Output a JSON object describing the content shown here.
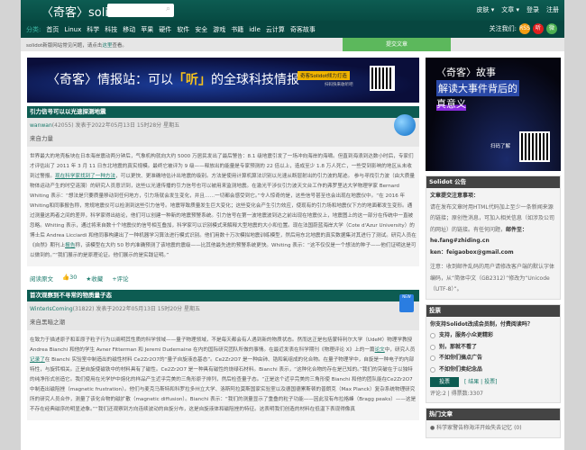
{
  "header": {
    "logo": "〈奇客〉solidot",
    "search_icon": "⌕",
    "skin": "皮肤 ▾",
    "article": "文章 ▾",
    "login": "登录",
    "register": "注册"
  },
  "nav": {
    "label": "分类:",
    "items": [
      "首页",
      "Linux",
      "科学",
      "科技",
      "移动",
      "苹果",
      "硬件",
      "软件",
      "安全",
      "游戏",
      "书籍",
      "idle",
      "云计算",
      "奇客故事"
    ],
    "follow": "关注我们:",
    "rss": "RSS",
    "listen": "听",
    "wechat": "微"
  },
  "notice": {
    "pre": "solidot新版网站常见问题，请点击",
    "link": "这里",
    "post": "查看。",
    "submit": "提交文章"
  },
  "banner": {
    "title_a": "〈奇客〉情报站：可以",
    "title_b": "「听」",
    "title_c": "的全球科技情报",
    "tag": "奇客Solidot倾力打造",
    "sub": "扫码快来收听吧"
  },
  "articles": [
    {
      "title": "引力信号可以以光速探测地震",
      "author": "wanwan",
      "meta": "(42055) 发表于2022年05月13日 15时28分 星期五",
      "from": "来自力量",
      "p1": "世界最大的地壳板块在日本海岸震动两分钟后，气象机构就向大约 5000 万居民发出了最后警告：8.1 级地震引发了一场冲向海岸的海啸。但直到海浪到达数小时后，专家们才评估出了 2011 年 3 月 11 日东北地震的真实规模。最终它被评为 9 级——释放出的能量是专家预测的 22 倍以上，造成至少 1.8 万人死亡，一些受到影响的地区从未收到过警报。",
      "link1": "现在科学家找到了一种方法",
      "p2": "，可以更快、更准确地估计出地震的级别。方法是使用计算机算法识别以光速从断层射出的引力波的尾迹。 参与寻找引力波（由大质量物体运动产生的时空涟漪）的研究人员意识到，这些以光速传播的引力信号也可以被用来监测地震。在激光干涉仪引力波天文台工作的弗罗里达大学物理学家 Bernard Whiting 表示：“想法是只要质量移动到任何地方，引力场就会发生变化，并且……一切都会感受到它。”令人惊奇的是，这些信号甚至也会出现在地震仪中。“在 2016 年 Whiting和同事报告称，常规地震仪可以检测到这些引力信号。地震导致质量发生巨大变化；这些变化会产生引力效应，使现有的引力场和地震仪下方的地面都发生变形。通过测量这两者之间的差异，科学家得出结论，他们可以创建一种新的地震预警系统。引力信号在第一波地震波到达之前出现在地震仪上，地震图上的这一部分在传统中一直被忽略。Whiting 表示，通过将来自数十个地震仪的信号相互叠加，科学家可以识别模式来解释大型地震的大小和位置。现在法国蔚蓝海岸大学（Cote d'Azur University）的博士后 Andrea Licciardi 和他同事构建出了一种机器学习算法进行模式识别。他们用数十万次模拟地震训练模型，然后用东北地震的真实数据集对其进行了测试。研究人员在《自然》期刊上",
      "link2": "报告",
      "p3": "称，该模型在大约 50 秒内准确预测了该地震的震级——比其他最先进的预警系统更快。Whiting 表示：“这不仅仅是一个想法的种子——他们证明这是可以做到的。”“我们展示的是原理论证。他们展示的是实践证明。”",
      "read": "阅读原文",
      "likes": "30",
      "fav": "收藏",
      "comment": "评论"
    },
    {
      "title": "首次观察到不寻常的物质量子态",
      "author": "WinterIsComing",
      "meta": "(31822) 发表于2022年05月13日 15时20分 星期五",
      "from": "来自黑暗之潮",
      "badge": "NEW",
      "p1": "在致力于描述原子和亚原子粒子行为以阐明其性质的科学领域——量子物理领域，不是每天都会有人遇到新的物质状态。然而这正是包括蒙特利尔大学（UdeM）物理学教授 Andrea Bianchi 和他的学生 Avner Fitterman 和 Jeremi Dudemaine 在内的国际研究团队所做的事情。在最近发表在科学期刊《物理评论 X》上的一篇",
      "link1": "论文",
      "mid": "中，研究人员",
      "link2": "记录了",
      "p2": "在 Bianchi 实验室中制造出的磁性材料 Ce2Zr2O7的“量子自旋液态基态”。Ce2Zr2O7 是一种由铈、锆和氧组成的化合物。在量子物理学中，自旋是一种电子的内部特性，与旋转相关。正是自旋使磁铁中的材料具有了磁性。Ce2Zr2O7 是一种具有磁性的烧绿石材料。Bianchi 表示，“这种化合物的存在是已知的。”我们的突破在于以独特的纯净形式创造它。我们使用在光学炉中熔化的样品产生近乎完美的三角形原子排列，然后检查量子态。“正是这个近乎完美的三角形使 Bianchi 和他的团队能在Ce2Zr2O7中制造出磁阻挫（magnetic frustration）。他们与麦克马斯特和科罗拉多州立大学、洛斯阿拉莫斯国家实验室以及德国德累斯顿的普朗克（Max Planck）复杂系统物理研究所的研究人员合作，测量了该化合物的磁扩散（magnetic diffusion）。Bianchi 表示：“我们的测量显示了重叠的粒子功能——因此没有布拉格峰（Bragg peaks）——这是不存在经典磁序的明显迹象。”“我们还观察到方向连续波动的自旋分布，这是自旋液体和磁阻挫的特征。这表明我们创造的材料在低温下表现得像真"
    }
  ],
  "sidebar": {
    "story": {
      "l1": "〈奇客〉故事",
      "l2": "解读大事件背后的",
      "l3": "真意义",
      "scan": "扫码了解"
    },
    "announce": {
      "title": "Solidot 公告",
      "head": "文章提交注意事项：",
      "text": "请在发布文章时用HTML代码加上至少一条新闻来源的链接；原创性消息，可加入相关信息（如涉及公司的网址）的链接。有任何问题，",
      "mail1": "邮件至：he.fang#zhiding.cn",
      "mail2": "ken：feigaobox@gmail.com",
      "note": "注意：收到邮件乱码的用户请修改客户端的默认字体编码，从“简体中文（GB2312）”修改为“Unicode（UTF-8）”。"
    },
    "poll": {
      "title": "投票",
      "question": "你支持Solidot改成会员制，付费阅读吗？",
      "options": [
        "支持，服务小众更精彩",
        "别，那就不看了",
        "不如你们搞点广告",
        "不如你们卖纪念品"
      ],
      "vote": "投票",
      "links": "[ 结果 | 投票]",
      "stats": "评论:2 | 得票数:3307"
    },
    "hot": {
      "title": "热门文章",
      "items": [
        "科学家警告称海洋开始失去记忆 (0)"
      ]
    }
  }
}
